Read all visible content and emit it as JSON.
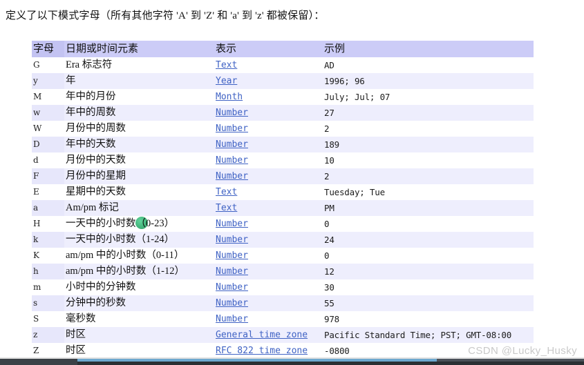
{
  "intro": {
    "text": "定义了以下模式字母（所有其他字符 'A' 到 'Z' 和 'a' 到 'z' 都被保留）："
  },
  "table": {
    "headers": {
      "letter": "字母",
      "element": "日期或时间元素",
      "presentation": "表示",
      "example": "示例"
    },
    "rows": [
      {
        "letter": "G",
        "element": "Era 标志符",
        "presentation": "Text",
        "example": "AD"
      },
      {
        "letter": "y",
        "element": "年",
        "presentation": "Year",
        "example": "1996; 96"
      },
      {
        "letter": "M",
        "element": "年中的月份",
        "presentation": "Month",
        "example": "July; Jul; 07"
      },
      {
        "letter": "w",
        "element": "年中的周数",
        "presentation": "Number",
        "example": "27"
      },
      {
        "letter": "W",
        "element": "月份中的周数",
        "presentation": "Number",
        "example": "2"
      },
      {
        "letter": "D",
        "element": "年中的天数",
        "presentation": "Number",
        "example": "189"
      },
      {
        "letter": "d",
        "element": "月份中的天数",
        "presentation": "Number",
        "example": "10"
      },
      {
        "letter": "F",
        "element": "月份中的星期",
        "presentation": "Number",
        "example": "2"
      },
      {
        "letter": "E",
        "element": "星期中的天数",
        "presentation": "Text",
        "example": "Tuesday; Tue"
      },
      {
        "letter": "a",
        "element": "Am/pm 标记",
        "presentation": "Text",
        "example": "PM"
      },
      {
        "letter": "H",
        "element": "一天中的小时数（0-23）",
        "presentation": "Number",
        "example": "0"
      },
      {
        "letter": "k",
        "element": "一天中的小时数（1-24）",
        "presentation": "Number",
        "example": "24"
      },
      {
        "letter": "K",
        "element": "am/pm 中的小时数（0-11）",
        "presentation": "Number",
        "example": "0"
      },
      {
        "letter": "h",
        "element": "am/pm 中的小时数（1-12）",
        "presentation": "Number",
        "example": "12"
      },
      {
        "letter": "m",
        "element": "小时中的分钟数",
        "presentation": "Number",
        "example": "30"
      },
      {
        "letter": "s",
        "element": "分钟中的秒数",
        "presentation": "Number",
        "example": "55"
      },
      {
        "letter": "S",
        "element": "毫秒数",
        "presentation": "Number",
        "example": "978"
      },
      {
        "letter": "z",
        "element": "时区",
        "presentation": "General time zone",
        "example": "Pacific Standard Time; PST; GMT-08:00"
      },
      {
        "letter": "Z",
        "element": "时区",
        "presentation": "RFC 822 time zone",
        "example": "-0800"
      }
    ]
  },
  "watermark": {
    "text": "CSDN @Lucky_Husky"
  },
  "colors": {
    "header_bg": "#ccccf7",
    "alt_row_bg": "#eeeefd",
    "link": "#3f62c4",
    "cursor": "#19a55f",
    "watermark": "#c9c9c9",
    "bottom_bar": "#2b2f33",
    "scroll_thumb": "#6da8cf"
  }
}
